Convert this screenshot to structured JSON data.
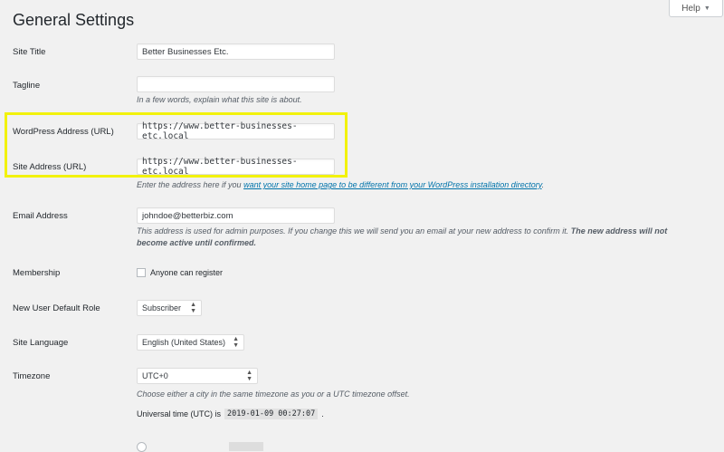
{
  "header": {
    "title": "General Settings",
    "help_label": "Help",
    "help_icon": "caret-down-icon"
  },
  "rows": {
    "site_title": {
      "label": "Site Title",
      "value": "Better Businesses Etc."
    },
    "tagline": {
      "label": "Tagline",
      "value": "",
      "description": "In a few words, explain what this site is about."
    },
    "wp_address": {
      "label": "WordPress Address (URL)",
      "value": "https://www.better-businesses-etc.local"
    },
    "site_address": {
      "label": "Site Address (URL)",
      "value": "https://www.better-businesses-etc.local",
      "desc_before": "Enter the address here if you ",
      "desc_link": "want your site home page to be different from your WordPress installation directory",
      "desc_after": "."
    },
    "email": {
      "label": "Email Address",
      "value": "johndoe@betterbiz.com",
      "desc_text": "This address is used for admin purposes. If you change this we will send you an email at your new address to confirm it. ",
      "desc_bold": "The new address will not become active until confirmed."
    },
    "membership": {
      "label": "Membership",
      "checkbox_label": "Anyone can register",
      "checked": false
    },
    "default_role": {
      "label": "New User Default Role",
      "value": "Subscriber"
    },
    "language": {
      "label": "Site Language",
      "value": "English (United States)"
    },
    "timezone": {
      "label": "Timezone",
      "value": "UTC+0",
      "description": "Choose either a city in the same timezone as you or a UTC timezone offset.",
      "utc_label": "Universal time (UTC) is",
      "utc_value": "2019-01-09 00:27:07",
      "utc_suffix": "."
    }
  },
  "colors": {
    "highlight": "#f2f20c",
    "link": "#0073aa",
    "background": "#f1f1f1"
  }
}
